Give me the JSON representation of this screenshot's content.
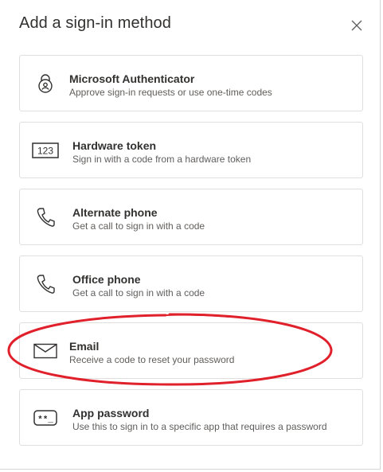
{
  "dialog": {
    "title": "Add a sign-in method",
    "close_icon": "close-icon"
  },
  "methods": [
    {
      "name": "Microsoft Authenticator",
      "description": "Approve sign-in requests or use one-time codes",
      "icon": "authenticator-lock-icon"
    },
    {
      "name": "Hardware token",
      "description": "Sign in with a code from a hardware token",
      "icon": "hardware-token-icon",
      "icon_text": "123"
    },
    {
      "name": "Alternate phone",
      "description": "Get a call to sign in with a code",
      "icon": "phone-icon"
    },
    {
      "name": "Office phone",
      "description": "Get a call to sign in with a code",
      "icon": "phone-icon"
    },
    {
      "name": "Email",
      "description": "Receive a code to reset your password",
      "icon": "envelope-icon"
    },
    {
      "name": "App password",
      "description": "Use this to sign in to a specific app that requires a password",
      "icon": "app-password-icon",
      "icon_text": "**_"
    }
  ],
  "annotation": {
    "highlighted_item": "Email",
    "color": "#e0202a"
  },
  "colors": {
    "text_primary": "#323130",
    "text_secondary": "#605e5c",
    "border": "#e1dfdd"
  }
}
